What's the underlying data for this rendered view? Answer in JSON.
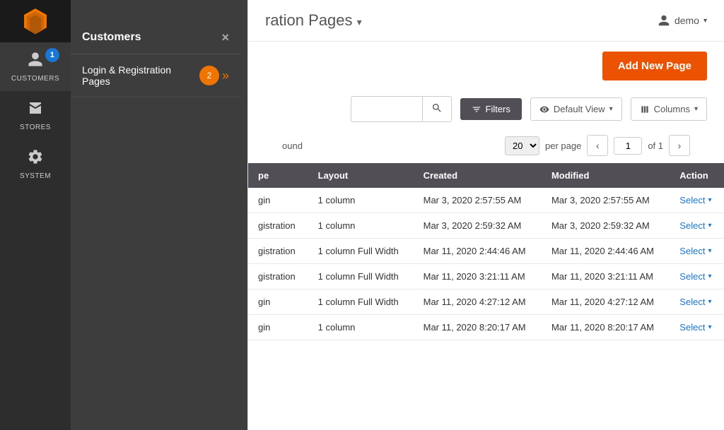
{
  "sidebar": {
    "logo_alt": "Magento Logo",
    "items": [
      {
        "id": "customers",
        "label": "CUSTOMERS",
        "icon": "👤",
        "badge": "1",
        "active": true
      },
      {
        "id": "stores",
        "label": "STORES",
        "icon": "🏪",
        "badge": null,
        "active": false
      },
      {
        "id": "system",
        "label": "SYSTEM",
        "icon": "⚙",
        "badge": null,
        "active": false
      }
    ]
  },
  "dropdown": {
    "title": "Customers",
    "close_label": "×",
    "badge_number": "2",
    "item_label": "Login & Registration Pages",
    "item_arrow": "»"
  },
  "header": {
    "title": "ration Pages",
    "title_suffix": "▾",
    "user_label": "demo",
    "user_arrow": "▾"
  },
  "toolbar": {
    "add_new_label": "Add New Page"
  },
  "search": {
    "placeholder": "",
    "filter_label": "Filters",
    "view_label": "Default View",
    "columns_label": "Columns"
  },
  "pagination": {
    "per_page": "20",
    "page_current": "1",
    "page_of": "of 1",
    "per_page_label": "per page"
  },
  "results": {
    "found_text": "ound"
  },
  "table": {
    "columns": [
      "pe",
      "Layout",
      "Created",
      "Modified",
      "Action"
    ],
    "rows": [
      {
        "type": "gin",
        "layout": "1 column",
        "created": "Mar 3, 2020 2:57:55 AM",
        "modified": "Mar 3, 2020 2:57:55 AM",
        "action": "Select"
      },
      {
        "type": "gistration",
        "layout": "1 column",
        "created": "Mar 3, 2020 2:59:32 AM",
        "modified": "Mar 3, 2020 2:59:32 AM",
        "action": "Select"
      },
      {
        "type": "gistration",
        "layout": "1 column Full Width",
        "created": "Mar 11, 2020 2:44:46 AM",
        "modified": "Mar 11, 2020 2:44:46 AM",
        "action": "Select"
      },
      {
        "type": "gistration",
        "layout": "1 column Full Width",
        "created": "Mar 11, 2020 3:21:11 AM",
        "modified": "Mar 11, 2020 3:21:11 AM",
        "action": "Select"
      },
      {
        "type": "gin",
        "layout": "1 column Full Width",
        "created": "Mar 11, 2020 4:27:12 AM",
        "modified": "Mar 11, 2020 4:27:12 AM",
        "action": "Select"
      },
      {
        "type": "gin",
        "layout": "1 column",
        "created": "Mar 11, 2020 8:20:17 AM",
        "modified": "Mar 11, 2020 8:20:17 AM",
        "action": "Select"
      }
    ]
  },
  "colors": {
    "accent_orange": "#eb5202",
    "sidebar_bg": "#2d2d2d",
    "dropdown_bg": "#3d3d3d",
    "table_header_bg": "#514e56",
    "action_blue": "#1976d2"
  }
}
